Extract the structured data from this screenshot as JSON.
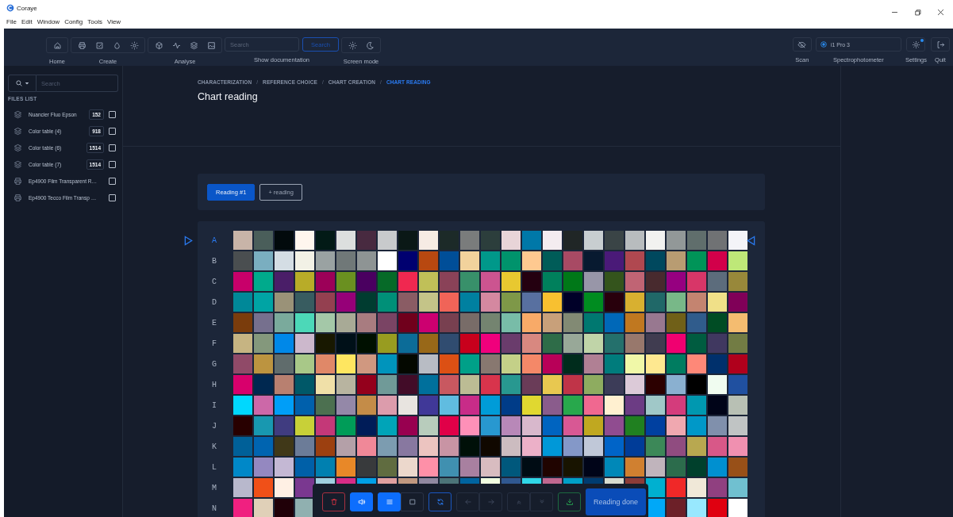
{
  "window": {
    "title": "Coraye"
  },
  "menu": [
    "File",
    "Edit",
    "Window",
    "Config",
    "Tools",
    "View"
  ],
  "toolbar": {
    "groups": [
      {
        "label": "Home",
        "kind": "icons"
      },
      {
        "label": "Create",
        "kind": "icons"
      },
      {
        "label": "Analyse",
        "kind": "icons"
      },
      {
        "label": "Show documentation",
        "kind": "search",
        "placeholder": "Search",
        "button": "Search"
      },
      {
        "label": "Screen mode",
        "kind": "icons"
      }
    ],
    "scan": {
      "label": "Scan"
    },
    "device": {
      "name": "i1 Pro 3",
      "label": "Spectrophotometer",
      "connected": true
    },
    "settings": {
      "label": "Settings",
      "notification": true
    },
    "quit": {
      "label": "Quit"
    }
  },
  "sidebar": {
    "search": {
      "placeholder": "Search"
    },
    "heading": "FILES LIST",
    "files": [
      {
        "kind": "layers",
        "name": "Nuancier Fluo Epson",
        "count": "152",
        "checked": false
      },
      {
        "kind": "layers",
        "name": "Color table (4)",
        "count": "918",
        "checked": false
      },
      {
        "kind": "layers",
        "name": "Color table (6)",
        "count": "1514",
        "checked": false
      },
      {
        "kind": "layers",
        "name": "Color table (7)",
        "count": "1514",
        "checked": false
      },
      {
        "kind": "printer",
        "name": "Ep4900 Film Transparent R…",
        "checked": false
      },
      {
        "kind": "printer",
        "name": "Ep4900 Tecco Film Transp …",
        "checked": false
      }
    ]
  },
  "breadcrumb": {
    "separator": "/",
    "items": [
      {
        "label": "CHARACTERIZATION",
        "selected": false
      },
      {
        "label": "REFERENCE CHOICE",
        "selected": false
      },
      {
        "label": "CHART CREATION",
        "selected": false
      },
      {
        "label": "CHART READING",
        "selected": true
      }
    ]
  },
  "title": "Chart reading",
  "readings": {
    "tabs": [
      {
        "label": "Reading #1",
        "selected": true
      }
    ],
    "add_button": "+ reading"
  },
  "chart": {
    "rows": [
      {
        "label": "A",
        "marked": true,
        "cells": [
          {
            "color": "#c8b4a8"
          },
          {
            "color": "#4a5e5a"
          },
          {
            "color": "#020a0c"
          },
          {
            "color": "#fff6ee"
          },
          {
            "color": "#021a16"
          },
          {
            "color": "#dcdfde"
          },
          {
            "color": "#482a40"
          },
          {
            "color": "#c8cacc"
          },
          {
            "color": "#0a1816"
          },
          {
            "color": "#f6ebe4"
          },
          {
            "color": "#1c2a28"
          },
          {
            "color": "#7a7c7c"
          },
          {
            "color": "#2c3e3c"
          },
          {
            "color": "#e8d4d8"
          },
          {
            "color": "#0078a8"
          },
          {
            "color": "#f4ecf0"
          },
          {
            "color": "#202626"
          },
          {
            "color": "#c8ced0"
          },
          {
            "color": "#3a4446"
          },
          {
            "color": "#b8bcbe"
          },
          {
            "color": "#f2f2f0"
          },
          {
            "color": "#929898"
          },
          {
            "color": "#606e6c"
          },
          {
            "color": "#707274"
          },
          {
            "color": "#f4f4f8"
          }
        ]
      },
      {
        "label": "B",
        "marked": false,
        "cells": [
          {
            "color": "#4a4e50"
          },
          {
            "color": "#7aaec0"
          },
          {
            "color": "#d4dde4"
          },
          {
            "color": "#f2f1e6"
          },
          {
            "color": "#9aa2a2"
          },
          {
            "color": "#707878"
          },
          {
            "color": "#8e9494"
          },
          {
            "color": "#ffffff"
          },
          {
            "color": "#000070"
          },
          {
            "color": "#b84810"
          },
          {
            "color": "#004e98"
          },
          {
            "color": "#f2d29c"
          },
          {
            "color": "#00988a"
          },
          {
            "color": "#00936c"
          },
          {
            "color": "#fec990"
          },
          {
            "color": "#005c58"
          },
          {
            "color": "#a84a64"
          },
          {
            "color": "#081a30"
          },
          {
            "color": "#4a1a78"
          },
          {
            "color": "#b04850"
          },
          {
            "color": "#00485e"
          },
          {
            "color": "#b89c72"
          },
          {
            "color": "#009458"
          },
          {
            "color": "#d2004a"
          },
          {
            "color": "#bee878"
          }
        ]
      },
      {
        "label": "C",
        "marked": false,
        "cells": [
          {
            "color": "#c8006a"
          },
          {
            "color": "#00aa8c"
          },
          {
            "color": "#4a1e68"
          },
          {
            "color": "#b8ac28"
          },
          {
            "color": "#9c0058"
          },
          {
            "color": "#6a9020"
          },
          {
            "color": "#4a0060"
          },
          {
            "color": "#066a28"
          },
          {
            "color": "#f02850"
          },
          {
            "color": "#c0c058"
          },
          {
            "color": "#8a4258"
          },
          {
            "color": "#38906a"
          },
          {
            "color": "#cc5490"
          },
          {
            "color": "#e8c830"
          },
          {
            "color": "#240010"
          },
          {
            "color": "#00805c"
          },
          {
            "color": "#007818"
          },
          {
            "color": "#9896a8"
          },
          {
            "color": "#34541c"
          },
          {
            "color": "#c06474"
          },
          {
            "color": "#482a2e"
          },
          {
            "color": "#960080"
          },
          {
            "color": "#d83668"
          },
          {
            "color": "#5c6c7c"
          },
          {
            "color": "#98883a"
          }
        ]
      },
      {
        "label": "D",
        "marked": false,
        "cells": [
          {
            "color": "#008898"
          },
          {
            "color": "#00a4a4"
          },
          {
            "color": "#9a9278"
          },
          {
            "color": "#385c60"
          },
          {
            "color": "#944050"
          },
          {
            "color": "#960078"
          },
          {
            "color": "#003c30"
          },
          {
            "color": "#009078"
          },
          {
            "color": "#8a5c64"
          },
          {
            "color": "#c4c488"
          },
          {
            "color": "#f06458"
          },
          {
            "color": "#0080a0"
          },
          {
            "color": "#d488a0"
          },
          {
            "color": "#7e9848"
          },
          {
            "color": "#5870a0"
          },
          {
            "color": "#f8c030"
          },
          {
            "color": "#000028"
          },
          {
            "color": "#008c20"
          },
          {
            "color": "#28000c"
          },
          {
            "color": "#d8b030"
          },
          {
            "color": "#206868"
          },
          {
            "color": "#78b888"
          },
          {
            "color": "#c48470"
          },
          {
            "color": "#f0e088"
          },
          {
            "color": "#800058"
          }
        ]
      },
      {
        "label": "E",
        "marked": false,
        "cells": [
          {
            "color": "#7a3c0c"
          },
          {
            "color": "#76708e"
          },
          {
            "color": "#7aaa9c"
          },
          {
            "color": "#4cd8b8"
          },
          {
            "color": "#a4c8a8"
          },
          {
            "color": "#a8aa96"
          },
          {
            "color": "#a87c80"
          },
          {
            "color": "#7a4464"
          },
          {
            "color": "#70001c"
          },
          {
            "color": "#cc0070"
          },
          {
            "color": "#784050"
          },
          {
            "color": "#786c68"
          },
          {
            "color": "#748470"
          },
          {
            "color": "#78bca8"
          },
          {
            "color": "#f8aa68"
          },
          {
            "color": "#c8a07a"
          },
          {
            "color": "#828a74"
          },
          {
            "color": "#007870"
          },
          {
            "color": "#0068b8"
          },
          {
            "color": "#c07820"
          },
          {
            "color": "#987890"
          },
          {
            "color": "#706018"
          },
          {
            "color": "#305c8c"
          },
          {
            "color": "#004c24"
          },
          {
            "color": "#f4bc70"
          }
        ]
      },
      {
        "label": "F",
        "marked": false,
        "cells": [
          {
            "color": "#c6b482"
          },
          {
            "color": "#84987c"
          },
          {
            "color": "#0088e8"
          },
          {
            "color": "#ccb8cc"
          },
          {
            "color": "#181800"
          },
          {
            "color": "#001018"
          },
          {
            "color": "#001000"
          },
          {
            "color": "#989c20"
          },
          {
            "color": "#0c6c98"
          },
          {
            "color": "#986818"
          },
          {
            "color": "#304c70"
          },
          {
            "color": "#c8001c"
          },
          {
            "color": "#f0007c"
          },
          {
            "color": "#6a3c6c"
          },
          {
            "color": "#d88880"
          },
          {
            "color": "#2e6c48"
          },
          {
            "color": "#98a898"
          },
          {
            "color": "#c0d4a8"
          },
          {
            "color": "#24706c"
          },
          {
            "color": "#98786c"
          },
          {
            "color": "#403c50"
          },
          {
            "color": "#f00070"
          },
          {
            "color": "#005c40"
          },
          {
            "color": "#403860"
          },
          {
            "color": "#727c44"
          }
        ]
      },
      {
        "label": "G",
        "marked": false,
        "cells": [
          {
            "color": "#904a68"
          },
          {
            "color": "#bc9440"
          },
          {
            "color": "#606c6c"
          },
          {
            "color": "#a8c888"
          },
          {
            "color": "#e08868"
          },
          {
            "color": "#fee660"
          },
          {
            "color": "#d09880"
          },
          {
            "color": "#0094bc"
          },
          {
            "color": "#040800"
          },
          {
            "color": "#b8bcc4"
          },
          {
            "color": "#dc5014"
          },
          {
            "color": "#00a088"
          },
          {
            "color": "#887870"
          },
          {
            "color": "#c4d088"
          },
          {
            "color": "#f48868"
          },
          {
            "color": "#b80058"
          },
          {
            "color": "#002c1c"
          },
          {
            "color": "#b08094"
          },
          {
            "color": "#007c7c"
          },
          {
            "color": "#f0f8a8"
          },
          {
            "color": "#fee890"
          },
          {
            "color": "#007c60"
          },
          {
            "color": "#fe8878"
          },
          {
            "color": "#00306c"
          },
          {
            "color": "#b0001c"
          }
        ]
      },
      {
        "label": "H",
        "marked": false,
        "cells": [
          {
            "color": "#d8006c"
          },
          {
            "color": "#002850"
          },
          {
            "color": "#b88070"
          },
          {
            "color": "#005868"
          },
          {
            "color": "#f0e0a8"
          },
          {
            "color": "#b8b4a0"
          },
          {
            "color": "#94001c"
          },
          {
            "color": "#709a98"
          },
          {
            "color": "#420c28"
          },
          {
            "color": "#00709c"
          },
          {
            "color": "#c85860"
          },
          {
            "color": "#bcbc94"
          },
          {
            "color": "#d8344c"
          },
          {
            "color": "#289890"
          },
          {
            "color": "#6a3c58"
          },
          {
            "color": "#e8c850"
          },
          {
            "color": "#c03448"
          },
          {
            "color": "#8eac60"
          },
          {
            "color": "#3c3c58"
          },
          {
            "color": "#dccad8"
          },
          {
            "color": "#2c0000"
          },
          {
            "color": "#8ab0d0"
          },
          {
            "color": "#000000"
          },
          {
            "color": "#f0fcf0"
          },
          {
            "color": "#2050a0"
          }
        ]
      },
      {
        "label": "I",
        "marked": false,
        "cells": [
          {
            "color": "#00d8fe"
          },
          {
            "color": "#cc68a8"
          },
          {
            "color": "#009ef8"
          },
          {
            "color": "#0060ac"
          },
          {
            "color": "#4c7050"
          },
          {
            "color": "#9488a8"
          },
          {
            "color": "#c48c48"
          },
          {
            "color": "#dc9cac"
          },
          {
            "color": "#e8e4e0"
          },
          {
            "color": "#403898"
          },
          {
            "color": "#60bce0"
          },
          {
            "color": "#c82c88"
          },
          {
            "color": "#009cd8"
          },
          {
            "color": "#003c88"
          },
          {
            "color": "#e0d830"
          },
          {
            "color": "#8a5c8c"
          },
          {
            "color": "#28a84c"
          },
          {
            "color": "#f06890"
          },
          {
            "color": "#fff0d0"
          },
          {
            "color": "#6c3c84"
          },
          {
            "color": "#a0c8c8"
          },
          {
            "color": "#d43c7c"
          },
          {
            "color": "#0098b0"
          },
          {
            "color": "#000418"
          },
          {
            "color": "#b8c0b4"
          }
        ]
      },
      {
        "label": "J",
        "marked": false,
        "cells": [
          {
            "color": "#280000"
          },
          {
            "color": "#1898b0"
          },
          {
            "color": "#403c80"
          },
          {
            "color": "#c8d038"
          },
          {
            "color": "#c43878"
          },
          {
            "color": "#009c58"
          },
          {
            "color": "#001c58"
          },
          {
            "color": "#00a4b8"
          },
          {
            "color": "#980050"
          },
          {
            "color": "#b8ccbc"
          },
          {
            "color": "#e00048"
          },
          {
            "color": "#fe90b8"
          },
          {
            "color": "#2898d0"
          },
          {
            "color": "#b888b8"
          },
          {
            "color": "#d8b8cc"
          },
          {
            "color": "#0064c0"
          },
          {
            "color": "#d85894"
          },
          {
            "color": "#c0a820"
          },
          {
            "color": "#904c90"
          },
          {
            "color": "#208020"
          },
          {
            "color": "#0040a0"
          },
          {
            "color": "#f0a8b0"
          },
          {
            "color": "#0098c8"
          },
          {
            "color": "#8090ac"
          },
          {
            "color": "#c0c4c4"
          }
        ]
      },
      {
        "label": "K",
        "marked": false,
        "cells": [
          {
            "color": "#006098"
          },
          {
            "color": "#0064b0"
          },
          {
            "color": "#403818"
          },
          {
            "color": "#6c7c98"
          },
          {
            "color": "#9c4010"
          },
          {
            "color": "#b4a0a8"
          },
          {
            "color": "#f08898"
          },
          {
            "color": "#7c9cb0"
          },
          {
            "color": "#8878a0"
          },
          {
            "color": "#ecc4c0"
          },
          {
            "color": "#c894a4"
          },
          {
            "color": "#001008"
          },
          {
            "color": "#100800"
          },
          {
            "color": "#ccbcc0"
          },
          {
            "color": "#ecb0c8"
          },
          {
            "color": "#0098d8"
          },
          {
            "color": "#8498c8"
          },
          {
            "color": "#c0c8d8"
          },
          {
            "color": "#0064c8"
          },
          {
            "color": "#003c98"
          },
          {
            "color": "#3c8858"
          },
          {
            "color": "#904c80"
          },
          {
            "color": "#b8a850"
          },
          {
            "color": "#d85888"
          },
          {
            "color": "#f090b0"
          }
        ]
      },
      {
        "label": "L",
        "marked": false,
        "cells": [
          {
            "color": "#0088c8"
          },
          {
            "color": "#9488c0"
          },
          {
            "color": "#c4b8d4"
          },
          {
            "color": "#0060a8"
          },
          {
            "color": "#0080b0"
          },
          {
            "color": "#e88828"
          },
          {
            "color": "#383a3c"
          },
          {
            "color": "#606c40"
          },
          {
            "color": "#ecd8cc"
          },
          {
            "color": "#fe90a8"
          },
          {
            "color": "#4090b0"
          },
          {
            "color": "#a880a0"
          },
          {
            "color": "#d8bcc0"
          },
          {
            "color": "#00587c"
          },
          {
            "color": "#000c14"
          },
          {
            "color": "#200400"
          },
          {
            "color": "#181400"
          },
          {
            "color": "#000418"
          },
          {
            "color": "#0088b8"
          },
          {
            "color": "#d08030"
          },
          {
            "color": "#c0b4bc"
          },
          {
            "color": "#2c6c4c"
          },
          {
            "color": "#00402c"
          },
          {
            "color": "#0090d0"
          },
          {
            "color": "#985018"
          }
        ]
      },
      {
        "label": "M",
        "marked": false,
        "cells": [
          {
            "color": "#b8b8cc"
          },
          {
            "color": "#f05018"
          },
          {
            "color": "#fff0e4"
          },
          {
            "color": "#7a3890"
          },
          {
            "color": "#a0d0e0"
          },
          {
            "color": "#d82c88"
          },
          {
            "color": "#00a0e8"
          },
          {
            "color": "#e0a0a0"
          },
          {
            "color": "#c09880"
          },
          {
            "color": "#9088a0"
          },
          {
            "color": "#4c7478"
          },
          {
            "color": "#0064a0"
          },
          {
            "color": "#f0fce0"
          },
          {
            "color": "#305890"
          },
          {
            "color": "#30d8e8"
          },
          {
            "color": "#c06890"
          },
          {
            "color": "#00a0c8"
          },
          {
            "color": "#003c70"
          },
          {
            "color": "#d8dcd0"
          },
          {
            "color": "#8c3c38"
          },
          {
            "color": "#00b0d0"
          },
          {
            "color": "#f02828"
          },
          {
            "color": "#f0e8d8"
          },
          {
            "color": "#904080"
          },
          {
            "color": "#70c0d0"
          }
        ]
      },
      {
        "label": "N",
        "marked": false,
        "cells": [
          {
            "color": "#f02080"
          },
          {
            "color": "#e0d0b8"
          },
          {
            "color": "#200008"
          },
          {
            "color": "#90b0b0"
          },
          null,
          null,
          null,
          null,
          null,
          null,
          null,
          null,
          null,
          null,
          null,
          null,
          null,
          null,
          null,
          null,
          {
            "color": "#00a8f8"
          },
          {
            "color": "#6c2028"
          },
          {
            "color": "#98e8fe"
          },
          {
            "color": "#e00010"
          },
          {
            "color": "#ffffff"
          }
        ]
      }
    ]
  },
  "bottom_bar": {
    "buttons": [
      {
        "kind": "delete",
        "active": false,
        "disabled": false
      },
      {
        "kind": "sound",
        "active": true,
        "disabled": false
      },
      {
        "kind": "list",
        "active": true,
        "disabled": false
      },
      {
        "kind": "square",
        "active": false,
        "disabled": false
      },
      {
        "kind": "refresh",
        "active": false,
        "disabled": false
      },
      {
        "kind": "left",
        "active": false,
        "disabled": true
      },
      {
        "kind": "right",
        "active": false,
        "disabled": true
      },
      {
        "kind": "up",
        "active": false,
        "disabled": true
      },
      {
        "kind": "down",
        "active": false,
        "disabled": true
      },
      {
        "kind": "download",
        "active": false,
        "disabled": false
      }
    ],
    "done_button": "Reading done"
  }
}
